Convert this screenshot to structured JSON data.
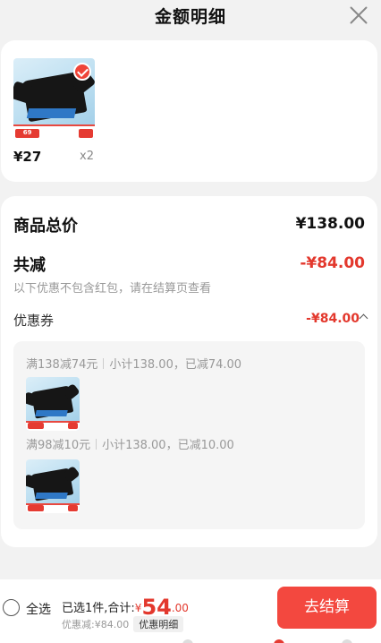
{
  "header": {
    "title": "金额明细",
    "close_icon": "close-icon"
  },
  "product": {
    "unit_price": "¥27",
    "quantity": "x2",
    "selected": true,
    "thumb_price_tag": "69",
    "thumb_icon": "tshirt-thumbnail"
  },
  "summary": {
    "total_label": "商品总价",
    "total_value": "¥138.00",
    "reduce_label": "共减",
    "reduce_value": "-¥84.00",
    "note": "以下优惠不包含红包，请在结算页查看",
    "coupon_label": "优惠券",
    "coupon_value": "-¥84.00",
    "coupon_caret_icon": "chevron-up-icon"
  },
  "coupons": [
    {
      "rule": "满138减74元",
      "detail": "小计138.00，已减74.00"
    },
    {
      "rule": "满98减10元",
      "detail": "小计138.00，已减10.00"
    }
  ],
  "bottom_bar": {
    "select_all": "全选",
    "selected_text": "已选1件,合计:",
    "currency": "¥",
    "total_integer": "54",
    "total_decimal": ".00",
    "discount_text": "优惠减:¥84.00",
    "detail_link": "优惠明细",
    "checkout": "去结算"
  },
  "colors": {
    "accent": "#f3483f",
    "price_red": "#e3382d",
    "background": "#f2f2f2"
  }
}
